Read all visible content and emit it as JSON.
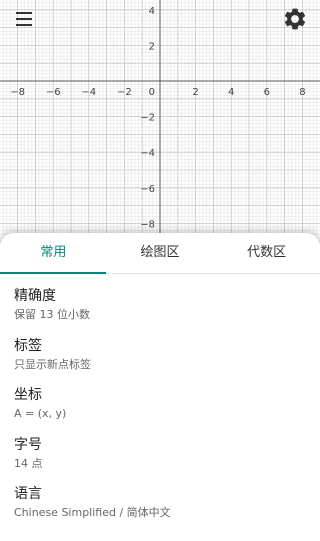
{
  "graph": {
    "x_ticks": [
      "−8",
      "−6",
      "−4",
      "−2",
      "0",
      "2",
      "4",
      "6",
      "8"
    ],
    "y_ticks_up": [
      "4",
      "2"
    ],
    "y_ticks_down": [
      "−2",
      "−4",
      "−6",
      "−8"
    ],
    "colors": {
      "major": "#c4c4c4",
      "minor": "#e6e6e6",
      "axis": "#555555",
      "label": "#444444"
    }
  },
  "toolbar": {
    "menu_icon": "menu-icon",
    "settings_icon": "gear-icon"
  },
  "tabs": [
    {
      "label": "常用",
      "active": true
    },
    {
      "label": "绘图区",
      "active": false
    },
    {
      "label": "代数区",
      "active": false
    }
  ],
  "settings": [
    {
      "title": "精确度",
      "value": "保留 13 位小数"
    },
    {
      "title": "标签",
      "value": "只显示新点标签"
    },
    {
      "title": "坐标",
      "value": "A = (x, y)"
    },
    {
      "title": "字号",
      "value": "14 点"
    },
    {
      "title": "语言",
      "value": "Chinese Simplified / 简体中文"
    }
  ],
  "accent_color": "#00877a"
}
